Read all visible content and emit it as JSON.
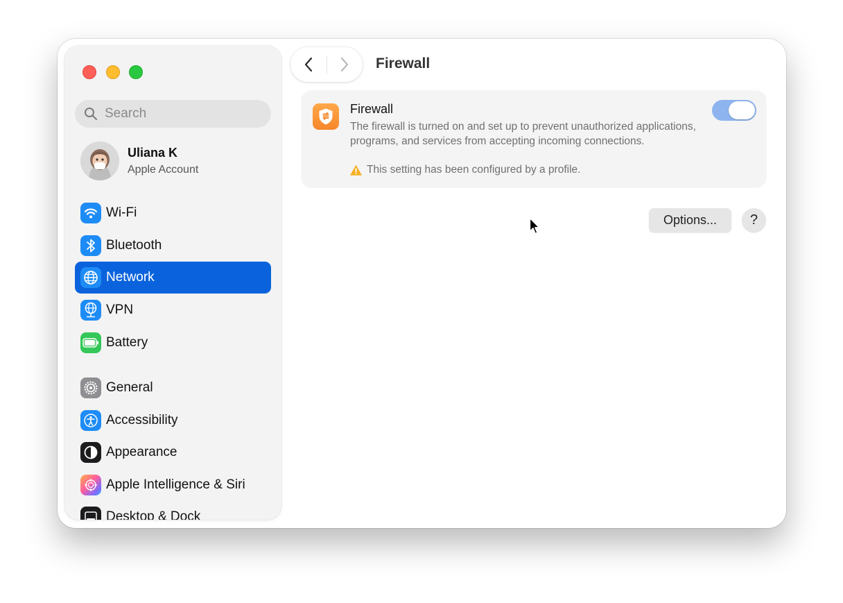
{
  "sidebar": {
    "search_placeholder": "Search",
    "account": {
      "name": "Uliana K",
      "subtitle": "Apple Account"
    },
    "items": [
      {
        "label": "Wi-Fi",
        "icon": "wifi-icon",
        "color": "#1e8cf6"
      },
      {
        "label": "Bluetooth",
        "icon": "bluetooth-icon",
        "color": "#1e8cf6"
      },
      {
        "label": "Network",
        "icon": "globe-icon",
        "color": "#1e8cf6",
        "selected": true
      },
      {
        "label": "VPN",
        "icon": "vpn-globe-icon",
        "color": "#1e8cf6"
      },
      {
        "label": "Battery",
        "icon": "battery-icon",
        "color": "#34c759"
      },
      {
        "label": "General",
        "icon": "gear-icon",
        "color": "#8e8e93"
      },
      {
        "label": "Accessibility",
        "icon": "accessibility-icon",
        "color": "#1e8cf6"
      },
      {
        "label": "Appearance",
        "icon": "appearance-icon",
        "color": "#1c1c1e"
      },
      {
        "label": "Apple Intelligence & Siri",
        "icon": "siri-icon",
        "color": "#ff7ab8"
      },
      {
        "label": "Desktop & Dock",
        "icon": "dock-icon",
        "color": "#1c1c1e"
      }
    ]
  },
  "toolbar": {
    "title": "Firewall"
  },
  "firewall": {
    "title": "Firewall",
    "description": "The firewall is turned on and set up to prevent unauthorized applications, programs, and services from accepting incoming connections.",
    "note": "This setting has been configured by a profile.",
    "enabled": true
  },
  "buttons": {
    "options": "Options...",
    "help": "?"
  },
  "colors": {
    "accent": "#0a63dc",
    "toggle_on_disabled": "#8db4ee",
    "warning": "#f5b022",
    "firewall_icon": "#f6872a"
  }
}
